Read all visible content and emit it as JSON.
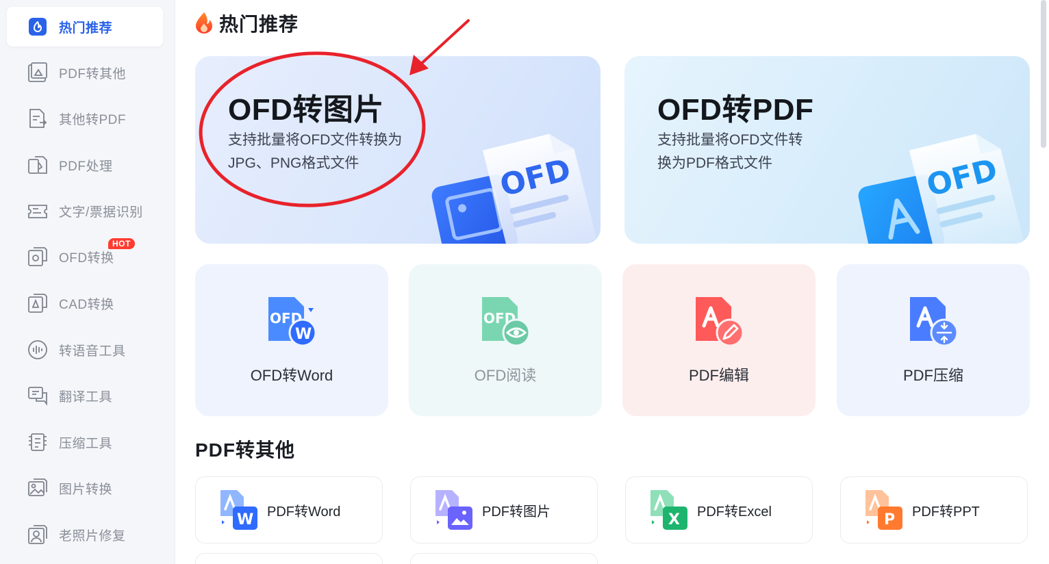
{
  "sidebar": {
    "items": [
      {
        "label": "热门推荐",
        "icon": "hot-recommend-icon",
        "active": true
      },
      {
        "label": "PDF转其他",
        "icon": "pdf-image-icon"
      },
      {
        "label": "其他转PDF",
        "icon": "document-convert-icon"
      },
      {
        "label": "PDF处理",
        "icon": "pdf-process-icon"
      },
      {
        "label": "文字/票据识别",
        "icon": "text-recognition-icon"
      },
      {
        "label": "OFD转换",
        "icon": "ofd-convert-icon",
        "badge": "HOT"
      },
      {
        "label": "CAD转换",
        "icon": "cad-icon"
      },
      {
        "label": "转语音工具",
        "icon": "audio-wave-icon"
      },
      {
        "label": "翻译工具",
        "icon": "translate-icon"
      },
      {
        "label": "压缩工具",
        "icon": "compress-icon"
      },
      {
        "label": "图片转换",
        "icon": "image-convert-icon"
      },
      {
        "label": "老照片修复",
        "icon": "photo-repair-icon"
      }
    ]
  },
  "main": {
    "hot_title": "热门推荐",
    "featured": [
      {
        "title": "OFD转图片",
        "desc": "支持批量将OFD文件转换为JPG、PNG格式文件",
        "icon_text": "OFD"
      },
      {
        "title": "OFD转PDF",
        "desc": "支持批量将OFD文件转换为PDF格式文件",
        "icon_text": "OFD"
      }
    ],
    "quick_tools": [
      {
        "label": "OFD转Word",
        "icon_text": "OFD",
        "icon_letter": "W"
      },
      {
        "label": "OFD阅读",
        "icon_text": "OFD"
      },
      {
        "label": "PDF编辑"
      },
      {
        "label": "PDF压缩"
      }
    ],
    "pdf_section_title": "PDF转其他",
    "pdf_tools": [
      {
        "label": "PDF转Word",
        "icon_letter": "W",
        "color": "#2f6bff"
      },
      {
        "label": "PDF转图片",
        "color": "#6a63ff"
      },
      {
        "label": "PDF转Excel",
        "icon_letter": "X",
        "color": "#1db56e"
      },
      {
        "label": "PDF转PPT",
        "icon_letter": "P",
        "color": "#ff7a2e"
      }
    ]
  },
  "colors": {
    "accent": "#2a62e8",
    "badge": "#ff3b30",
    "annotation": "#e8222b"
  }
}
